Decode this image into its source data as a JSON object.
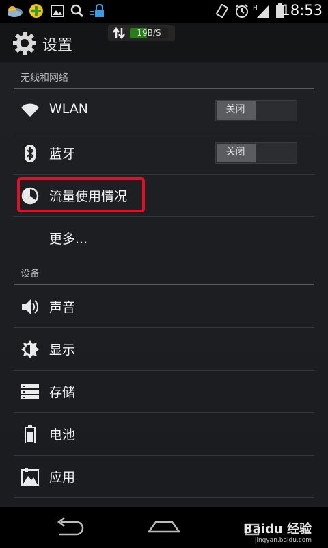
{
  "status_bar": {
    "time": "18:53",
    "icons_left": [
      "weather-icon",
      "green-plus-icon",
      "image-icon",
      "search-icon",
      "lock-icon"
    ],
    "icons_right": [
      "vibrate-icon",
      "alarm-icon",
      "signal-h-icon",
      "battery-icon"
    ]
  },
  "action_bar": {
    "title": "设置",
    "speed": {
      "value": "19B/S",
      "level": 0.45
    }
  },
  "sections": [
    {
      "header": "无线和网络"
    },
    {
      "header": "设备"
    }
  ],
  "rows": [
    {
      "label": "WLAN",
      "icon": "wifi-icon",
      "toggle": "关闭"
    },
    {
      "label": "蓝牙",
      "icon": "bluetooth-icon",
      "toggle": "关闭"
    },
    {
      "label": "流量使用情况",
      "icon": "data-usage-icon",
      "highlighted": true
    },
    {
      "label": "更多...",
      "icon": ""
    },
    {
      "label": "声音",
      "icon": "speaker-icon"
    },
    {
      "label": "显示",
      "icon": "brightness-icon"
    },
    {
      "label": "存储",
      "icon": "storage-icon"
    },
    {
      "label": "电池",
      "icon": "battery-icon"
    },
    {
      "label": "应用",
      "icon": "apps-icon"
    }
  ],
  "watermark": {
    "main": "Baidu 经验",
    "sub": "jingyan.baidu.com"
  },
  "colors": {
    "highlight": "#e1102a",
    "speed_fill": "#2a7d1a",
    "background": "#1e2024"
  }
}
